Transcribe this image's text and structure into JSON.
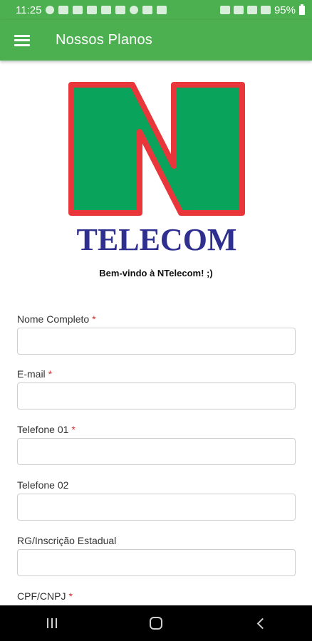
{
  "status_bar": {
    "time": "11:25",
    "battery": "95%",
    "notification_icons": [
      "whatsapp-icon",
      "youtube-icon",
      "youtube-icon",
      "youtube-icon",
      "youtube-icon",
      "news-icon",
      "facebook-icon",
      "download-icon",
      "facebook-icon",
      "image-icon"
    ],
    "status_icons": [
      "mute-icon",
      "wifi-icon",
      "signal-icon",
      "signal-icon",
      "battery-icon"
    ]
  },
  "app_bar": {
    "title": "Nossos Planos",
    "background_color": "#4caf50"
  },
  "logo": {
    "letter": "N",
    "brand": "TELECOM",
    "fill_color": "#0aa35b",
    "outline_color": "#e8363a",
    "text_color": "#2f2f8f"
  },
  "welcome_text": "Bem-vindo à NTelecom! ;)",
  "form": {
    "fields": [
      {
        "label": "Nome Completo",
        "required": "*",
        "value": ""
      },
      {
        "label": "E-mail",
        "required": "*",
        "value": ""
      },
      {
        "label": "Telefone 01",
        "required": "*",
        "value": ""
      },
      {
        "label": "Telefone 02",
        "required": "",
        "value": ""
      },
      {
        "label": "RG/Inscrição Estadual",
        "required": "",
        "value": ""
      },
      {
        "label": "CPF/CNPJ",
        "required": "*",
        "value": ""
      }
    ]
  },
  "nav_bar": {
    "buttons": [
      "recents-icon",
      "home-icon",
      "back-icon"
    ]
  }
}
